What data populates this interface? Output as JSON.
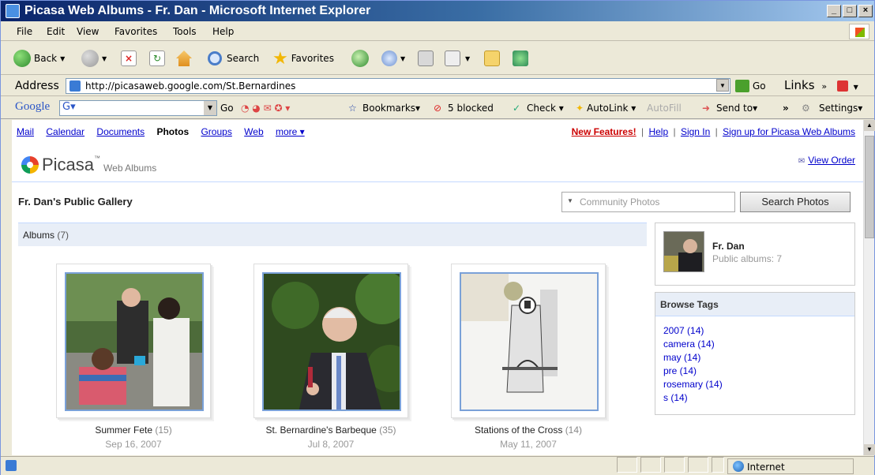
{
  "window": {
    "title": "Picasa Web Albums - Fr. Dan - Microsoft Internet Explorer",
    "controls": [
      "_",
      "□",
      "×"
    ]
  },
  "menu": [
    "File",
    "Edit",
    "View",
    "Favorites",
    "Tools",
    "Help"
  ],
  "toolbar": {
    "back": "Back",
    "search": "Search",
    "favorites": "Favorites"
  },
  "address": {
    "label": "Address",
    "url": "http://picasaweb.google.com/St.Bernardines",
    "go": "Go",
    "links": "Links"
  },
  "google_toolbar": {
    "logo": "Google",
    "search_value": "G▾",
    "go": "Go",
    "bookmarks": "Bookmarks▾",
    "blocked": "5 blocked",
    "check": "Check ▾",
    "autolink": "AutoLink ▾",
    "autofill": "AutoFill",
    "send_to": "Send to▾",
    "more": "»",
    "settings": "Settings▾"
  },
  "page": {
    "nav": {
      "mail": "Mail",
      "calendar": "Calendar",
      "documents": "Documents",
      "photos": "Photos",
      "groups": "Groups",
      "web": "Web",
      "more": "more ▾"
    },
    "top_links": {
      "new_features": "New Features!",
      "help": "Help",
      "sign_in": "Sign In",
      "sign_up": "Sign up for Picasa Web Albums",
      "separator": "|"
    },
    "logo": {
      "name": "Picasa",
      "tm": "™",
      "sub": "Web Albums"
    },
    "view_order": "View Order",
    "gallery_title": "Fr. Dan's Public Gallery",
    "search": {
      "placeholder": "Community Photos",
      "button": "Search Photos"
    },
    "albums_header": {
      "label": "Albums",
      "count": "(7)"
    },
    "albums": [
      {
        "title": "Summer Fete",
        "count": "(15)",
        "date": "Sep 16, 2007"
      },
      {
        "title": "St. Bernardine's Barbeque",
        "count": "(35)",
        "date": "Jul 8, 2007"
      },
      {
        "title": "Stations of the Cross",
        "count": "(14)",
        "date": "May 11, 2007"
      }
    ],
    "owner": {
      "name": "Fr. Dan",
      "public_albums": "Public albums: 7"
    },
    "browse_tags": {
      "heading": "Browse Tags",
      "tags": [
        "2007 (14)",
        "camera (14)",
        "may (14)",
        "pre (14)",
        "rosemary (14)",
        "s (14)"
      ]
    }
  },
  "status": {
    "zone": "Internet"
  }
}
